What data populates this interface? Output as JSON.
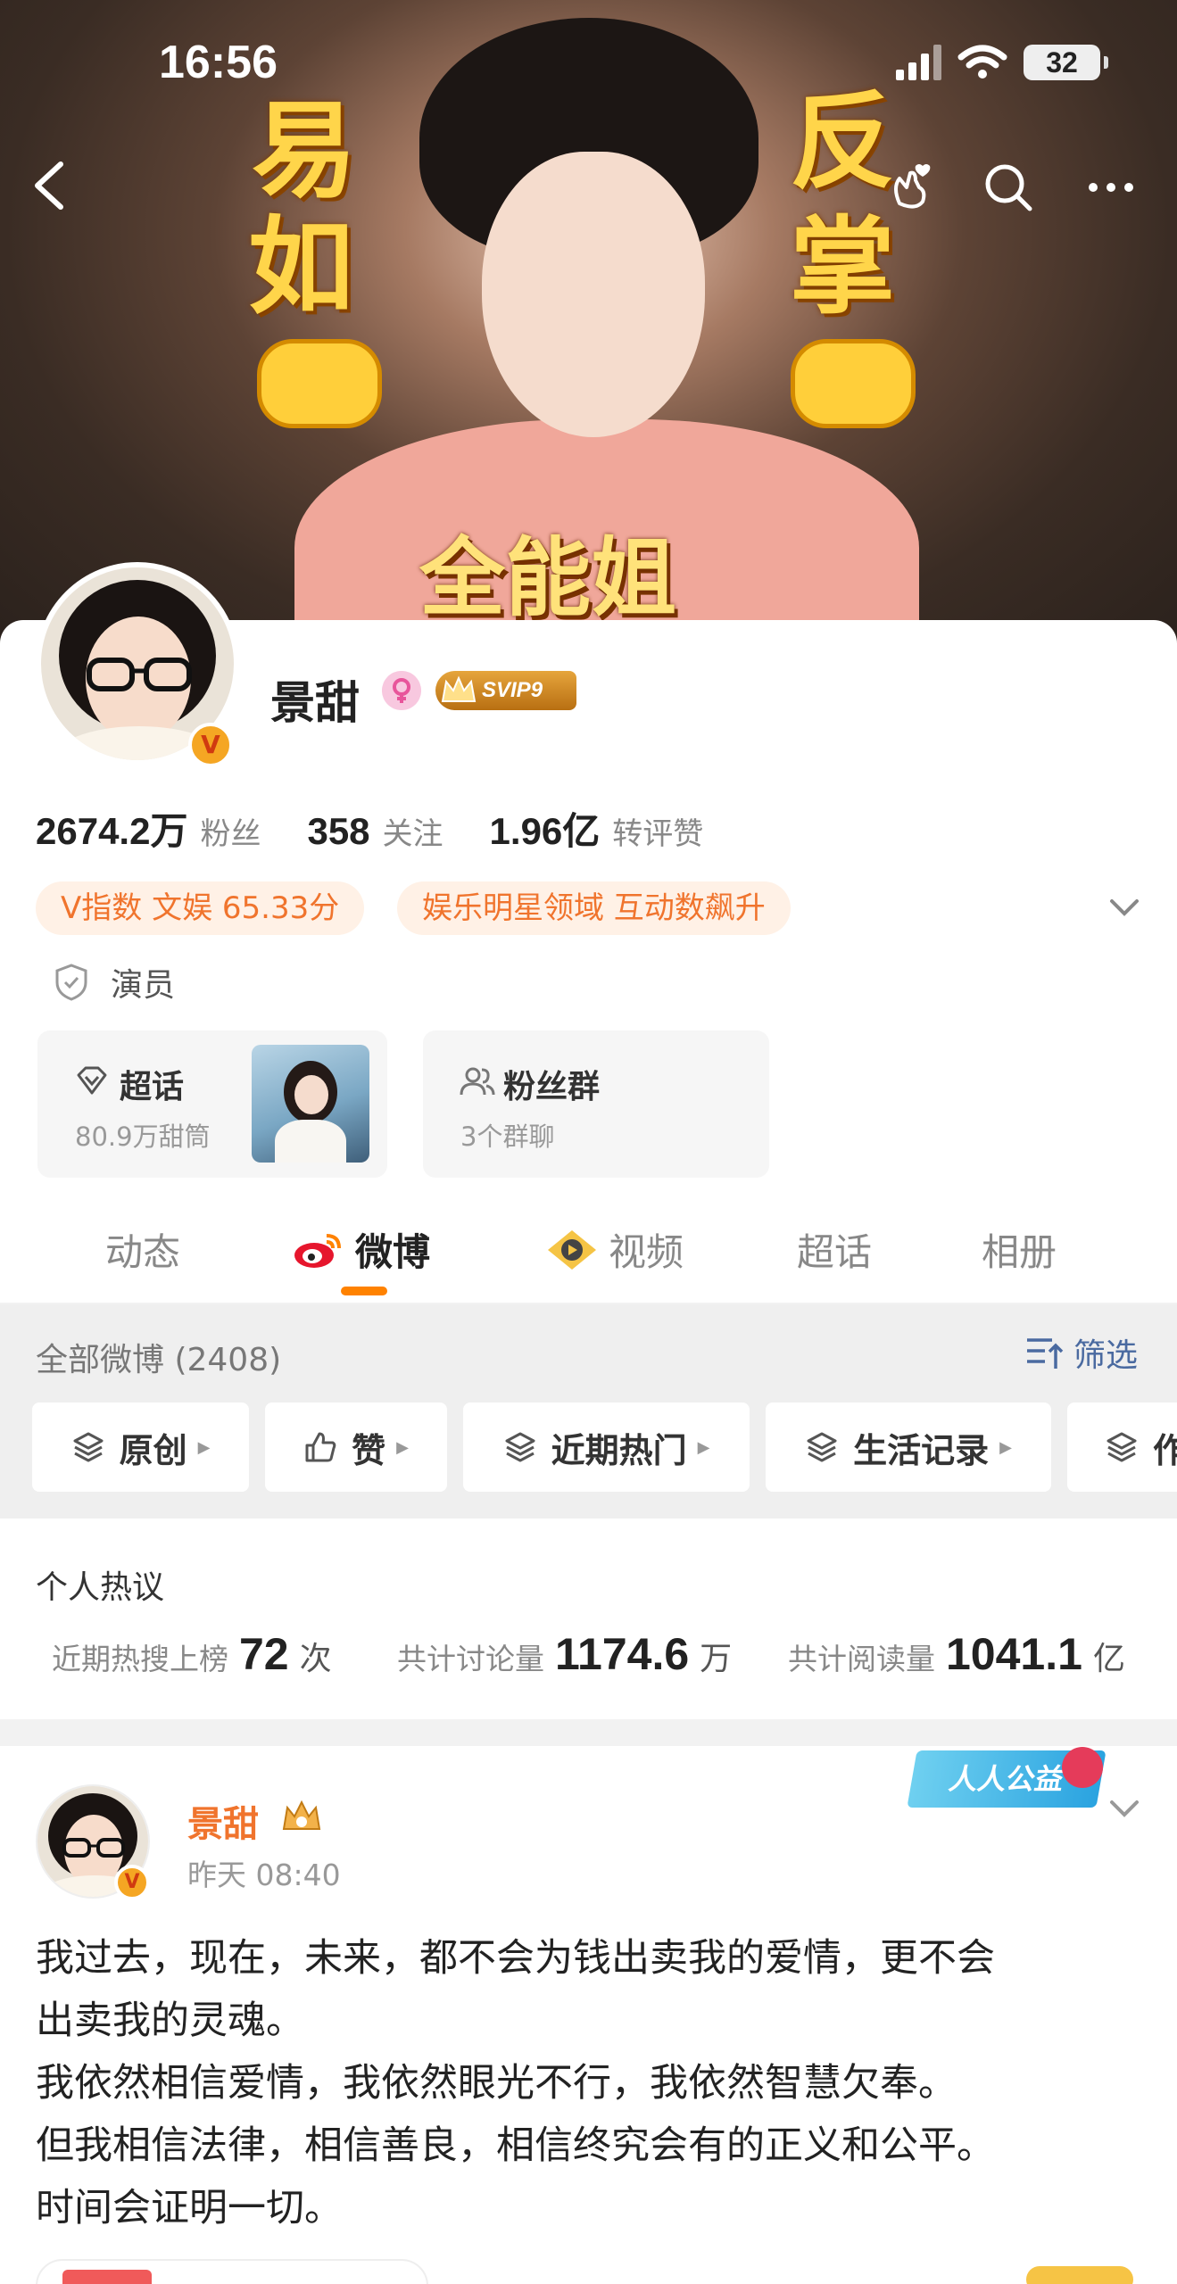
{
  "status": {
    "time": "16:56",
    "battery": "32"
  },
  "banner": {
    "left_chars": [
      "易",
      "如"
    ],
    "right_chars": [
      "反",
      "掌"
    ],
    "bottom_text": "全能姐"
  },
  "profile": {
    "name": "景甜",
    "vip_label": "SVIP9",
    "verified_mark": "V",
    "stats": [
      {
        "value": "2674.2万",
        "label": "粉丝"
      },
      {
        "value": "358",
        "label": "关注"
      },
      {
        "value": "1.96亿",
        "label": "转评赞"
      }
    ],
    "tags": [
      "V指数 文娱 65.33分",
      "娱乐明星领域 互动数飙升"
    ],
    "role": "演员",
    "cards": [
      {
        "title": "超话",
        "sub": "80.9万甜筒"
      },
      {
        "title": "粉丝群",
        "sub": "3个群聊"
      }
    ]
  },
  "tabs": [
    {
      "label": "动态",
      "active": false
    },
    {
      "label": "微博",
      "active": true
    },
    {
      "label": "视频",
      "active": false
    },
    {
      "label": "超话",
      "active": false
    },
    {
      "label": "相册",
      "active": false
    }
  ],
  "feed": {
    "all_label": "全部微博 (2408)",
    "filter_label": "筛选",
    "chips": [
      "原创",
      "赞",
      "近期热门",
      "生活记录",
      "作"
    ]
  },
  "hot": {
    "title": "个人热议",
    "items": [
      {
        "label": "近期热搜上榜",
        "value": "72",
        "unit": "次"
      },
      {
        "label": "共计讨论量",
        "value": "1174.6",
        "unit": "万"
      },
      {
        "label": "共计阅读量",
        "value": "1041.1",
        "unit": "亿"
      }
    ]
  },
  "post": {
    "author": "景甜",
    "time": "昨天 08:40",
    "charity_label": "人人公益",
    "lines": [
      "我过去，现在，未来，都不会为钱出卖我的爱情，更不会",
      "出卖我的灵魂。",
      "我依然相信爱情，我依然眼光不行，我依然智慧欠奉。",
      "但我相信法律，相信善良，相信终究会有的正义和公平。",
      "时间会证明一切。"
    ]
  },
  "colors": {
    "accent": "#ff8200",
    "tag_text": "#f0742d",
    "tag_bg": "#fff1e6",
    "filter_blue": "#4a6aa0"
  }
}
